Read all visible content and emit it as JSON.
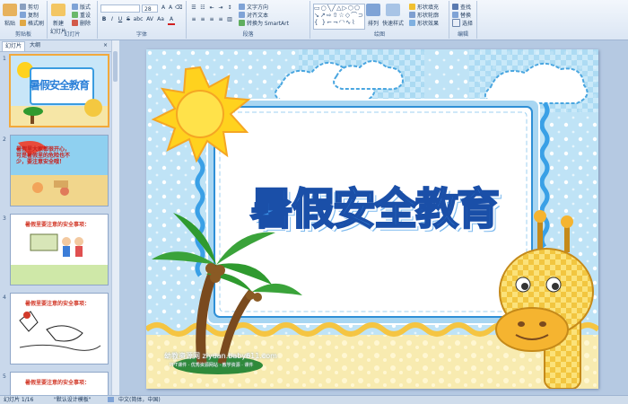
{
  "ribbon": {
    "clipboard": {
      "paste": "粘贴",
      "cut": "剪切",
      "copy": "复制",
      "format_painter": "格式刷",
      "label": "剪贴板"
    },
    "slides": {
      "new_slide": "新建\n幻灯片",
      "layout": "版式",
      "reset": "重设",
      "delete": "删除",
      "label": "幻灯片"
    },
    "font": {
      "font_name": "",
      "font_size": "28",
      "label": "字体",
      "bold": "B",
      "italic": "I",
      "underline": "U",
      "strike": "S",
      "shadow": "abc",
      "spacing": "AV",
      "case": "Aa",
      "color": "A"
    },
    "paragraph": {
      "text_direction": "文字方向",
      "align_text": "对齐文本",
      "smartart": "转换为 SmartArt",
      "label": "段落"
    },
    "drawing": {
      "arrange": "排列",
      "quick_styles": "快速样式",
      "shape_fill": "形状填充",
      "shape_outline": "形状轮廓",
      "shape_effects": "形状效果",
      "label": "绘图"
    },
    "editing": {
      "find": "查找",
      "replace": "替换",
      "select": "选择",
      "label": "编辑"
    }
  },
  "panel_tabs": {
    "slides": "幻灯片",
    "outline": "大纲",
    "close": "×"
  },
  "thumbnails": [
    {
      "num": "1",
      "selected": true,
      "title": "暑假安全教育"
    },
    {
      "num": "2",
      "selected": false,
      "text": "暑假里大家都很开心，可是暑假里的危险也不少，要注意安全哦！"
    },
    {
      "num": "3",
      "selected": false,
      "text": "暑假里要注意的安全事项："
    },
    {
      "num": "4",
      "selected": false,
      "text": "暑假里要注意的安全事项："
    },
    {
      "num": "5",
      "selected": false,
      "text": "暑假里要注意的安全事项："
    }
  ],
  "slide": {
    "title": "暑假安全教育",
    "watermark_main": "幼教资源网 ziyuan.baby611.com",
    "watermark_sub": "PPT课件 · 优秀资源网站 · 教学资源 · 课件"
  },
  "status": {
    "slide_info": "幻灯片 1/16",
    "theme": "\"默认设计模板\"",
    "language": "中文(简体，中国)"
  },
  "colors": {
    "ribbon": "#dbe6f4",
    "panel": "#c9d8eb",
    "editor": "#b5c9e2",
    "title_fill": "#3b8fe4",
    "selection": "#f2a93b"
  }
}
